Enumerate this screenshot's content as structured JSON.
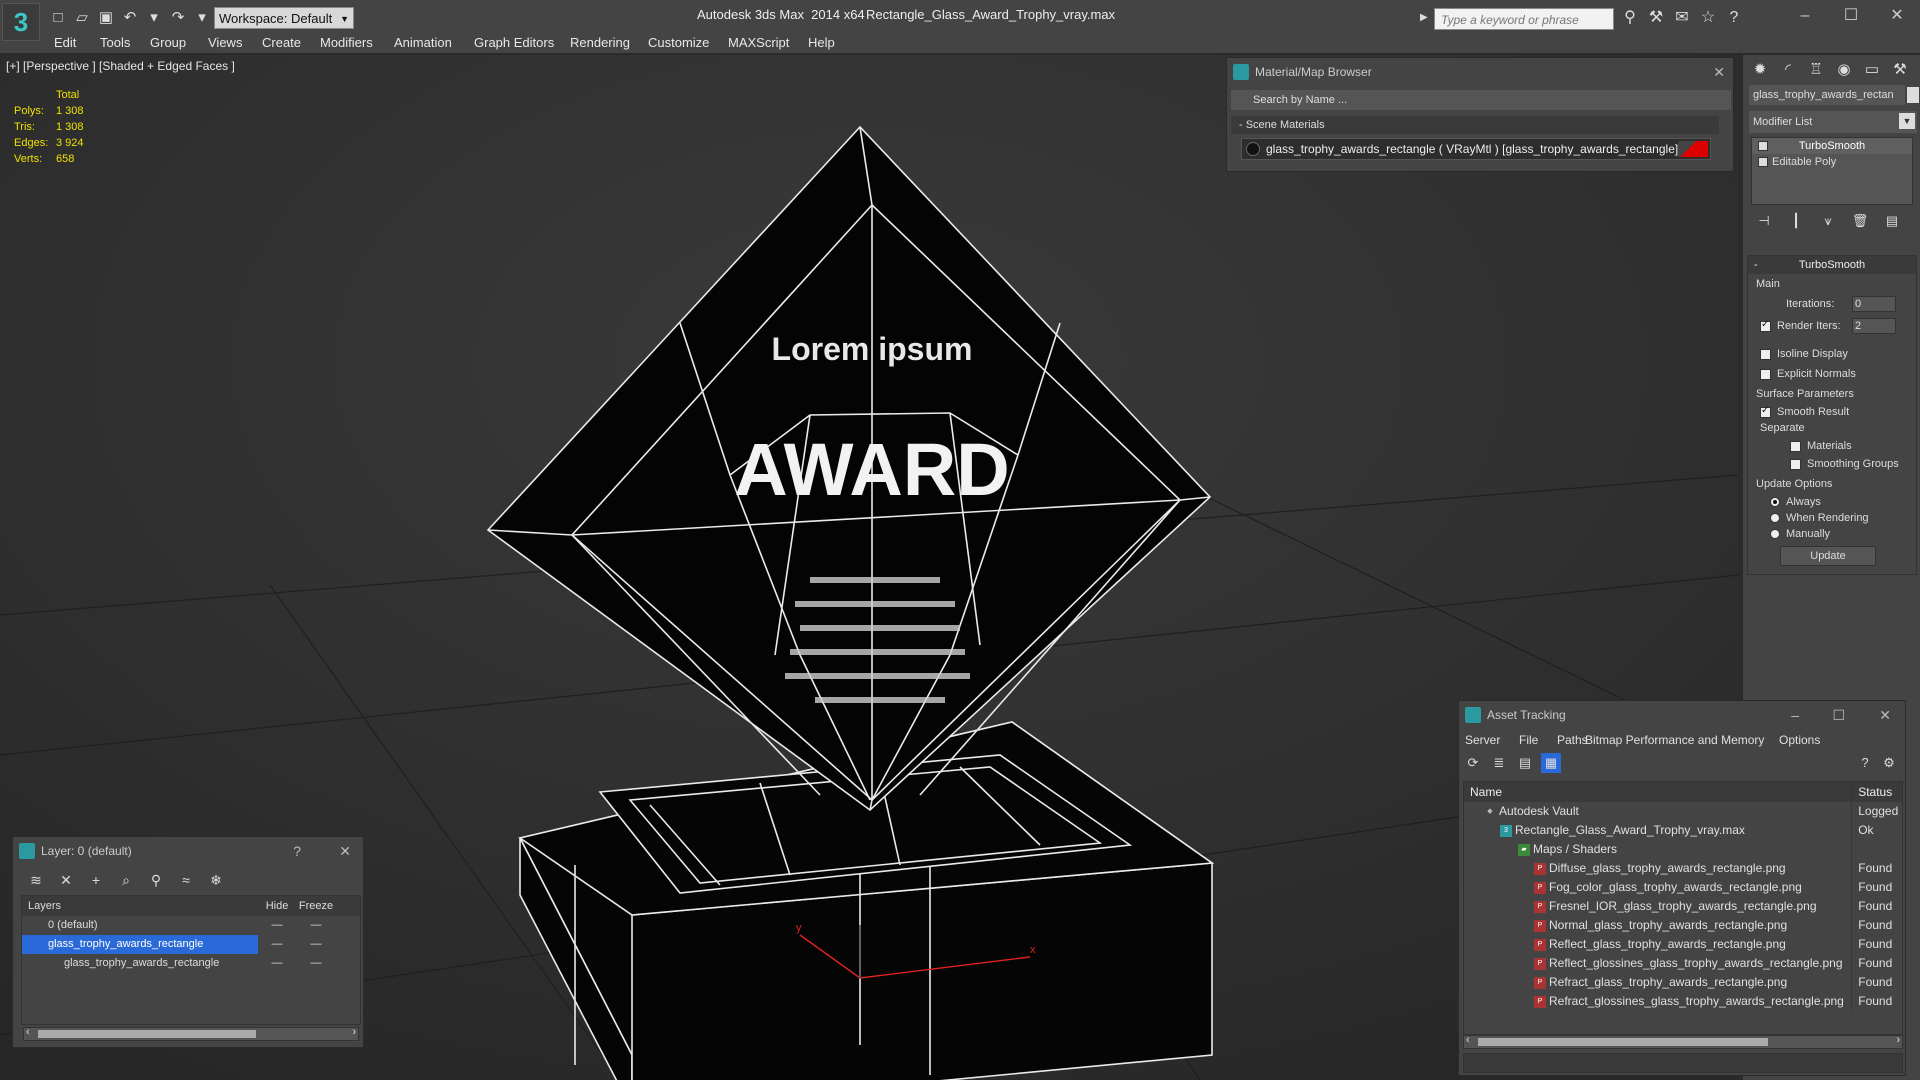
{
  "title_bar": {
    "app_title": "Autodesk 3ds Max  2014 x64",
    "file_name": "Rectangle_Glass_Award_Trophy_vray.max",
    "workspace": "Workspace: Default",
    "search_placeholder": "Type a keyword or phrase"
  },
  "menu": [
    "Edit",
    "Tools",
    "Group",
    "Views",
    "Create",
    "Modifiers",
    "Animation",
    "Graph Editors",
    "Rendering",
    "Customize",
    "MAXScript",
    "Help"
  ],
  "viewport": {
    "label": "[+] [Perspective ] [Shaded + Edged Faces ]",
    "stats": {
      "header": "Total",
      "rows": [
        {
          "label": "Polys:",
          "value": "1 308"
        },
        {
          "label": "Tris:",
          "value": "1 308"
        },
        {
          "label": "Edges:",
          "value": "3 924"
        },
        {
          "label": "Verts:",
          "value": "658"
        }
      ]
    },
    "trophy_text": {
      "line1": "Lorem ipsum",
      "line2": "AWARD"
    },
    "axis_x": "x",
    "axis_y": "y"
  },
  "material_browser": {
    "title": "Material/Map Browser",
    "search_placeholder": "Search by Name ...",
    "section": "- Scene Materials",
    "item": "glass_trophy_awards_rectangle ( VRayMtl ) [glass_trophy_awards_rectangle]"
  },
  "command_panel": {
    "object_name": "glass_trophy_awards_rectan",
    "modifier_list": "Modifier List",
    "stack": [
      "TurboSmooth",
      "Editable Poly"
    ],
    "rollout_title": "TurboSmooth",
    "main_group": "Main",
    "iterations_label": "Iterations:",
    "iterations_value": "0",
    "render_iters_label": "Render Iters:",
    "render_iters_value": "2",
    "isoline_display": "Isoline Display",
    "explicit_normals": "Explicit Normals",
    "surface_params": "Surface Parameters",
    "smooth_result": "Smooth Result",
    "separate": "Separate",
    "materials": "Materials",
    "smoothing_groups": "Smoothing Groups",
    "update_options": "Update Options",
    "always": "Always",
    "when_rendering": "When Rendering",
    "manually": "Manually",
    "update_button": "Update"
  },
  "layers": {
    "title": "Layer: 0 (default)",
    "col_layers": "Layers",
    "col_hide": "Hide",
    "col_freeze": "Freeze",
    "rows": [
      "0 (default)",
      "glass_trophy_awards_rectangle",
      "glass_trophy_awards_rectangle"
    ]
  },
  "asset_tracking": {
    "title": "Asset Tracking",
    "menu": [
      "Server",
      "File",
      "Paths",
      "Bitmap Performance and Memory",
      "Options"
    ],
    "col_name": "Name",
    "col_status": "Status",
    "rows": [
      {
        "name": "Autodesk Vault",
        "status": "Logged Out",
        "indent": 0
      },
      {
        "name": "Rectangle_Glass_Award_Trophy_vray.max",
        "status": "Ok",
        "indent": 1
      },
      {
        "name": "Maps / Shaders",
        "status": "",
        "indent": 2
      },
      {
        "name": "Diffuse_glass_trophy_awards_rectangle.png",
        "status": "Found",
        "indent": 3
      },
      {
        "name": "Fog_color_glass_trophy_awards_rectangle.png",
        "status": "Found",
        "indent": 3
      },
      {
        "name": "Fresnel_IOR_glass_trophy_awards_rectangle.png",
        "status": "Found",
        "indent": 3
      },
      {
        "name": "Normal_glass_trophy_awards_rectangle.png",
        "status": "Found",
        "indent": 3
      },
      {
        "name": "Reflect_glass_trophy_awards_rectangle.png",
        "status": "Found",
        "indent": 3
      },
      {
        "name": "Reflect_glossines_glass_trophy_awards_rectangle.png",
        "status": "Found",
        "indent": 3
      },
      {
        "name": "Refract_glass_trophy_awards_rectangle.png",
        "status": "Found",
        "indent": 3
      },
      {
        "name": "Refract_glossines_glass_trophy_awards_rectangle.png",
        "status": "Found",
        "indent": 3
      }
    ]
  }
}
